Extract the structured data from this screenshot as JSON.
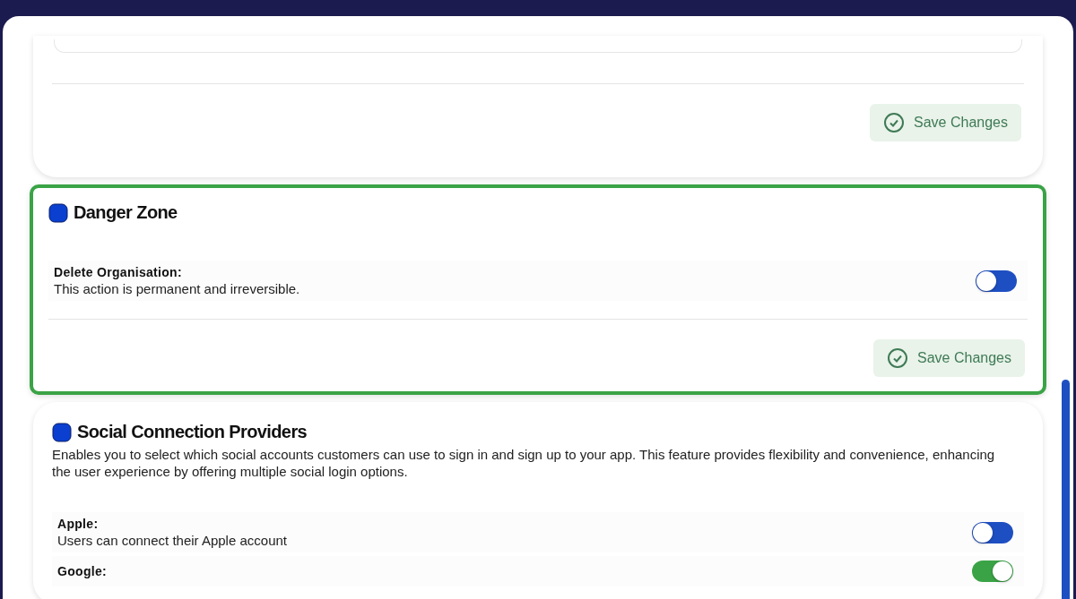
{
  "top_card": {
    "save_button": "Save Changes"
  },
  "danger_zone": {
    "title": "Danger Zone",
    "highlighted": true,
    "rows": [
      {
        "label": "Delete Organisation:",
        "description": "This action is permanent and irreversible.",
        "on": false
      }
    ],
    "save_button": "Save Changes"
  },
  "social_providers": {
    "title": "Social Connection Providers",
    "description": "Enables you to select which social accounts customers can use to sign in and sign up to your app. This feature provides flexibility and convenience, enhancing the user experience by offering multiple social login options.",
    "rows": [
      {
        "label": "Apple:",
        "description": "Users can connect their Apple account",
        "on": false
      },
      {
        "label": "Google:",
        "on": true
      }
    ]
  }
}
